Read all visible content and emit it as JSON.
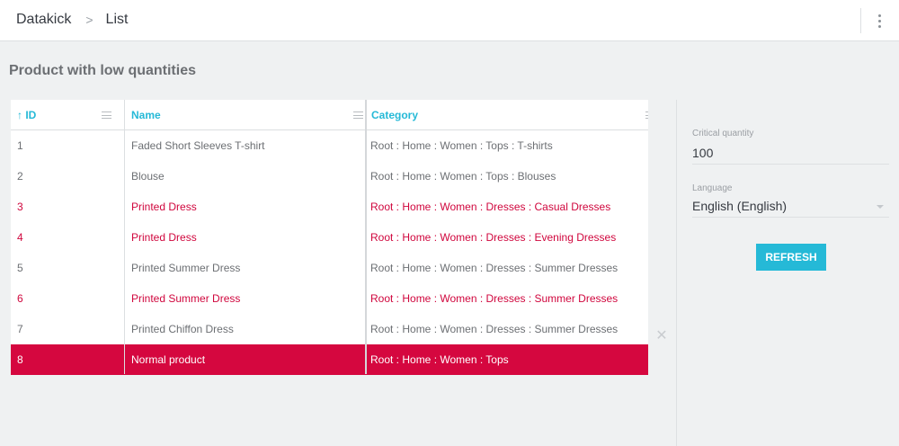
{
  "breadcrumb": {
    "root": "Datakick",
    "separator": ">",
    "current": "List"
  },
  "page": {
    "title": "Product with low quantities"
  },
  "grid": {
    "columns": {
      "id": "↑ ID",
      "name": "Name",
      "category": "Category"
    },
    "rows": [
      {
        "id": "1",
        "name": "Faded Short Sleeves T-shirt",
        "category": "Root : Home : Women : Tops : T-shirts",
        "state": "normal"
      },
      {
        "id": "2",
        "name": "Blouse",
        "category": "Root : Home : Women : Tops : Blouses",
        "state": "normal"
      },
      {
        "id": "3",
        "name": "Printed Dress",
        "category": "Root : Home : Women : Dresses : Casual Dresses",
        "state": "warn"
      },
      {
        "id": "4",
        "name": "Printed Dress",
        "category": "Root : Home : Women : Dresses : Evening Dresses",
        "state": "warn"
      },
      {
        "id": "5",
        "name": "Printed Summer Dress",
        "category": "Root : Home : Women : Dresses : Summer Dresses",
        "state": "normal"
      },
      {
        "id": "6",
        "name": "Printed Summer Dress",
        "category": "Root : Home : Women : Dresses : Summer Dresses",
        "state": "warn"
      },
      {
        "id": "7",
        "name": "Printed Chiffon Dress",
        "category": "Root : Home : Women : Dresses : Summer Dresses",
        "state": "normal"
      },
      {
        "id": "8",
        "name": "Normal product",
        "category": "Root : Home : Women : Tops",
        "state": "selected"
      }
    ]
  },
  "close_icon": "✕",
  "settings": {
    "critical_quantity": {
      "label": "Critical quantity",
      "value": "100"
    },
    "language": {
      "label": "Language",
      "value": "English (English)"
    },
    "refresh_label": "REFRESH"
  },
  "colors": {
    "accent": "#25b9d7",
    "warn": "#d0063d",
    "selected": "#d5073f"
  }
}
